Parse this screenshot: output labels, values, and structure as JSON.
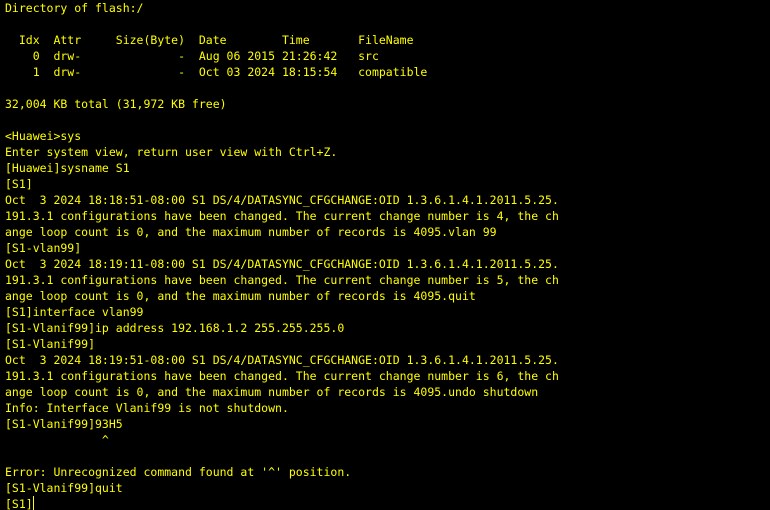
{
  "terminal": {
    "text_color": "#ffff00",
    "background": "#000000",
    "dir_header": "Directory of flash:/",
    "table_header": "  Idx  Attr     Size(Byte)  Date        Time       FileName",
    "rows": [
      "    0  drw-              -  Aug 06 2015 21:26:42   src",
      "    1  drw-              -  Oct 03 2024 18:15:54   compatible"
    ],
    "total": "32,004 KB total (31,972 KB free)",
    "lines": [
      "<Huawei>sys",
      "Enter system view, return user view with Ctrl+Z.",
      "[Huawei]sysname S1",
      "[S1]",
      "Oct  3 2024 18:18:51-08:00 S1 DS/4/DATASYNC_CFGCHANGE:OID 1.3.6.1.4.1.2011.5.25.",
      "191.3.1 configurations have been changed. The current change number is 4, the ch",
      "ange loop count is 0, and the maximum number of records is 4095.vlan 99",
      "[S1-vlan99]",
      "Oct  3 2024 18:19:11-08:00 S1 DS/4/DATASYNC_CFGCHANGE:OID 1.3.6.1.4.1.2011.5.25.",
      "191.3.1 configurations have been changed. The current change number is 5, the ch",
      "ange loop count is 0, and the maximum number of records is 4095.quit",
      "[S1]interface vlan99",
      "[S1-Vlanif99]ip address 192.168.1.2 255.255.255.0",
      "[S1-Vlanif99]",
      "Oct  3 2024 18:19:51-08:00 S1 DS/4/DATASYNC_CFGCHANGE:OID 1.3.6.1.4.1.2011.5.25.",
      "191.3.1 configurations have been changed. The current change number is 6, the ch",
      "ange loop count is 0, and the maximum number of records is 4095.undo shutdown",
      "Info: Interface Vlanif99 is not shutdown.",
      "[S1-Vlanif99]93H5",
      "              ^",
      "",
      "Error: Unrecognized command found at '^' position.",
      "[S1-Vlanif99]quit"
    ],
    "prompt": "[S1]"
  }
}
